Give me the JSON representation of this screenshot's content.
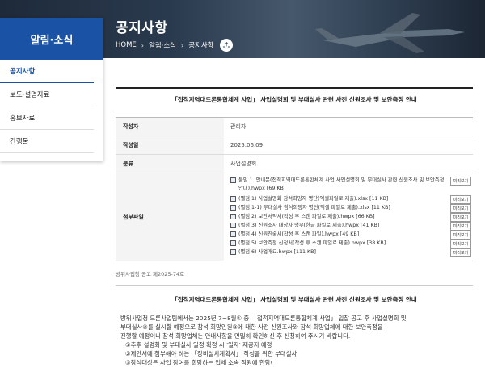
{
  "header": {
    "page_title": "공지사항",
    "breadcrumb": [
      "HOME",
      "알림·소식",
      "공지사항"
    ],
    "share_icon": "share-icon"
  },
  "sidebar": {
    "title": "알림·소식",
    "items": [
      {
        "label": "공지사항",
        "active": true
      },
      {
        "label": "보도·설명자료",
        "active": false
      },
      {
        "label": "홍보자료",
        "active": false
      },
      {
        "label": "간행물",
        "active": false
      }
    ]
  },
  "post": {
    "title": "「접적지역대드론통합체계 사업」 사업설명회 및 부대실사 관련 사전 신원조사 및 보안측정 안내",
    "fields": [
      {
        "label": "작성자",
        "value": "관리자"
      },
      {
        "label": "작성일",
        "value": "2025.06.09"
      },
      {
        "label": "분류",
        "value": "사업설명회"
      }
    ],
    "attachments_label": "첨부파일",
    "preview_label": "미리보기",
    "attachments": [
      "붙임 1. 안내문(접적지역대드론통합체계 사업 사업설명회 및 부대실사 관련 신원조사 및 보안측정 안내).hwpx [69 KB]",
      "(별첨 1) 사업설명회 참석희망자 명단(엑셀파일로 제출).xlsx [11 KB]",
      "(별첨 1-1) 부대실사 참석희망자 명단(엑셀 파일로 제출).xlsx [11 KB]",
      "(별첨 2) 보안서약서(작성 후 스캔 파일로 제출).hwpx [66 KB]",
      "(별첨 3) 신원조사 대상자 명부(한글 파일로 제출).hwpx [41 KB]",
      "(별첨 4) 신원진술서(작성 후 스캔 파일).hwpx [49 KB]",
      "(별첨 5) 보안측정 신청서(작성 후 스캔 파일로 제출).hwpx [38 KB]",
      "(별첨 6) 사업개요.hwpx [111 KB]"
    ],
    "notice_no": "방위사업청 공고 제2025-74호",
    "body_title": "「접적지역대드론통합체계 사업」 사업설명회 및 부대실사 관련 사전 신원조사 및 보안측정 안내",
    "body_lines": [
      "방위사업청 드론사업팀에서는 2025년 7~8월① 중 「접적지역대드론통합체계 사업」 입찰 공고 후 사업설명회 및",
      "부대실사②를 실시할 예정으로 참석 희망인원③에 대한 사전 신원조사와 참석 희망업체에 대한 보안측정을",
      "진행할 예정이니 참석 희망업체는 안내사항을 면밀히 확인하신 후 신청하여 주시기 바랍니다.",
      "①추후 설명회 및 부대실사 일정 확정 시 '일자' 재공지 예정",
      "②제안서에 첨부해야 하는 「장비설치계획서」 작성을 위한 부대실사",
      "③참석대상은 사업 참여를 희망하는 업체 소속 직원에 한함\\"
    ]
  },
  "colors": {
    "brand": "#1a53a6",
    "banner": "#2a3a4e"
  }
}
